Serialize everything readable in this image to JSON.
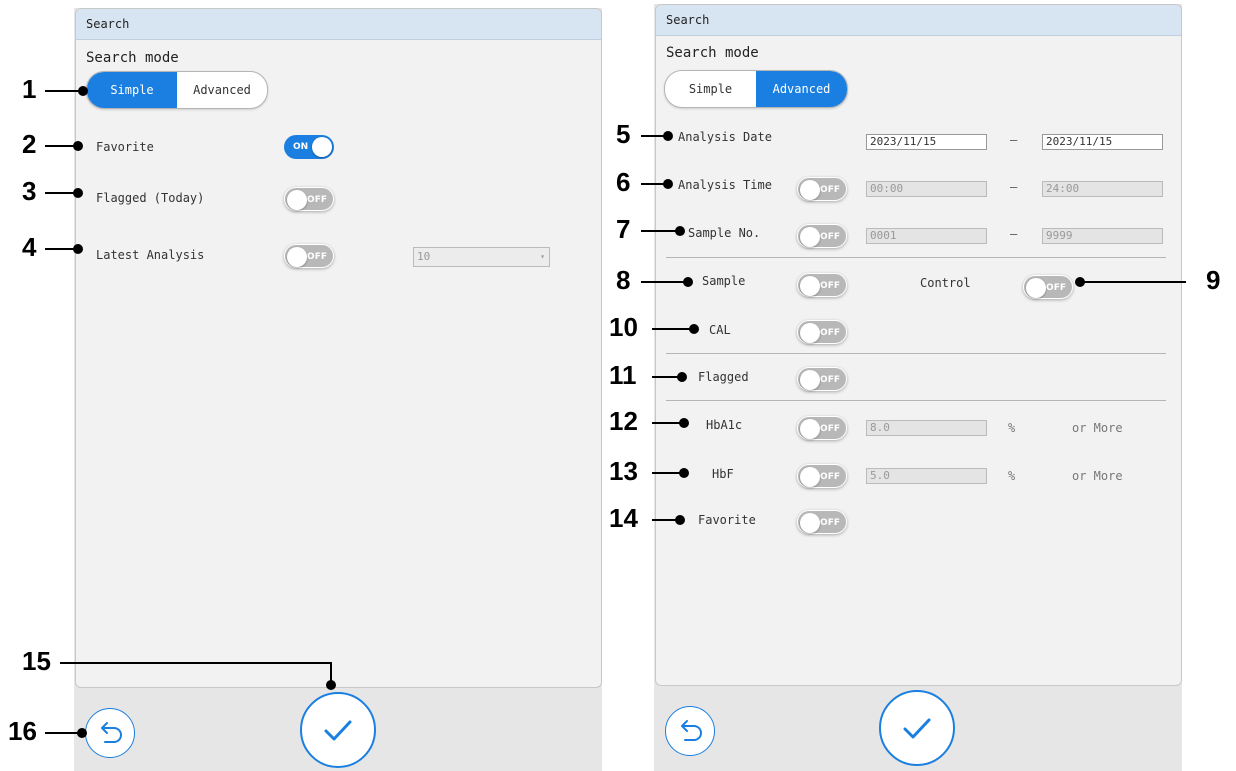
{
  "left_panel": {
    "header": "Search",
    "mode_label": "Search mode",
    "mode_simple": "Simple",
    "mode_advanced": "Advanced",
    "favorite": {
      "label": "Favorite",
      "toggle": "ON"
    },
    "flagged_today": {
      "label": "Flagged (Today)",
      "toggle": "OFF"
    },
    "latest_analysis": {
      "label": "Latest Analysis",
      "toggle": "OFF",
      "value": "10"
    }
  },
  "right_panel": {
    "header": "Search",
    "mode_label": "Search mode",
    "mode_simple": "Simple",
    "mode_advanced": "Advanced",
    "analysis_date": {
      "label": "Analysis Date",
      "from": "2023/11/15",
      "dash": "—",
      "to": "2023/11/15"
    },
    "analysis_time": {
      "label": "Analysis Time",
      "toggle": "OFF",
      "from": "00:00",
      "dash": "—",
      "to": "24:00"
    },
    "sample_no": {
      "label": "Sample No.",
      "toggle": "OFF",
      "from": "0001",
      "dash": "—",
      "to": "9999"
    },
    "sample": {
      "label": "Sample",
      "toggle": "OFF"
    },
    "control": {
      "label": "Control",
      "toggle": "OFF"
    },
    "cal": {
      "label": "CAL",
      "toggle": "OFF"
    },
    "flagged": {
      "label": "Flagged",
      "toggle": "OFF"
    },
    "hba1c": {
      "label": "HbA1c",
      "toggle": "OFF",
      "value": "8.0",
      "unit": "%",
      "suffix": "or More"
    },
    "hbf": {
      "label": "HbF",
      "toggle": "OFF",
      "value": "5.0",
      "unit": "%",
      "suffix": "or More"
    },
    "favorite": {
      "label": "Favorite",
      "toggle": "OFF"
    }
  },
  "callouts": [
    "1",
    "2",
    "3",
    "4",
    "5",
    "6",
    "7",
    "8",
    "9",
    "10",
    "11",
    "12",
    "13",
    "14",
    "15",
    "16"
  ],
  "icons": {
    "back": "undo-arrow-icon",
    "confirm": "checkmark-icon"
  },
  "colors": {
    "accent": "#1a7fe0",
    "header": "#d7e4f2",
    "toggle_off": "#b8b8b8"
  }
}
